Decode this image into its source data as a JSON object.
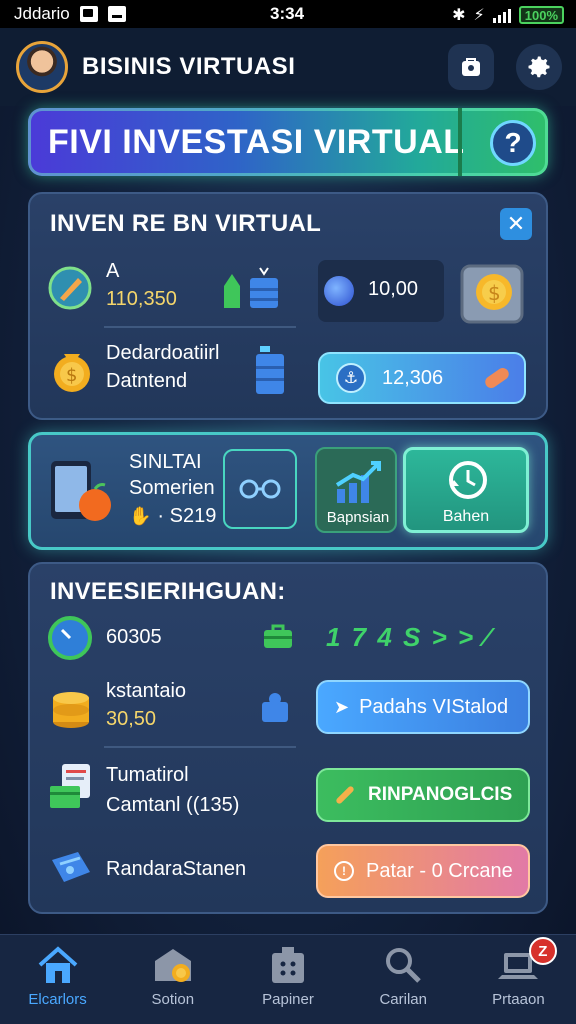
{
  "statusbar": {
    "carrier": "Jddario",
    "time": "3:34",
    "battery": "100%"
  },
  "header": {
    "title": "BISINIS VIRTUASI"
  },
  "banner": {
    "title": "FIVI INVESTASI VIRTUAL",
    "help_label": "?"
  },
  "card1": {
    "title": "INVEN RE BN VIRTUAL",
    "row1": {
      "label": "A",
      "value": "110,350",
      "amount": "10,00"
    },
    "row2": {
      "label": "Dedardoatiirl",
      "sublabel": "Datntend",
      "amount": "12,306"
    }
  },
  "card2": {
    "title": "SINLTAI",
    "subtitle": "Somerien",
    "value": "· S219",
    "action1_label": "Bapnsian",
    "action2_label": "Bahen"
  },
  "card3": {
    "title": "INVEESIERIHGUAN:",
    "row1": {
      "value": "60305",
      "sequence": "1 7 4 S > > ⁄"
    },
    "row2": {
      "label": "kstantaio",
      "value": "30,50",
      "button": "Padahs VIStalod"
    },
    "row3": {
      "label": "Tumatirol",
      "sublabel": "Camtanl ((135)",
      "button": "RINPANOGLCIS"
    },
    "row4": {
      "label": "RandaraStanen",
      "button": "Patar - 0 Crcane"
    }
  },
  "bottom_nav": [
    {
      "label": "Elcarlors",
      "icon": "home-icon",
      "active": true
    },
    {
      "label": "Sotion",
      "icon": "storage-icon",
      "active": false
    },
    {
      "label": "Papiner",
      "icon": "briefcase-icon",
      "active": false
    },
    {
      "label": "Carilan",
      "icon": "search-icon",
      "active": false
    },
    {
      "label": "Prtaaon",
      "icon": "laptop-icon",
      "active": false,
      "badge": "Z"
    }
  ],
  "colors": {
    "accent_green": "#2fbf6a",
    "accent_blue": "#4aa8ff",
    "accent_teal": "#48c9c7",
    "button_orange": "#f58a55",
    "badge_red": "#d7312b"
  }
}
